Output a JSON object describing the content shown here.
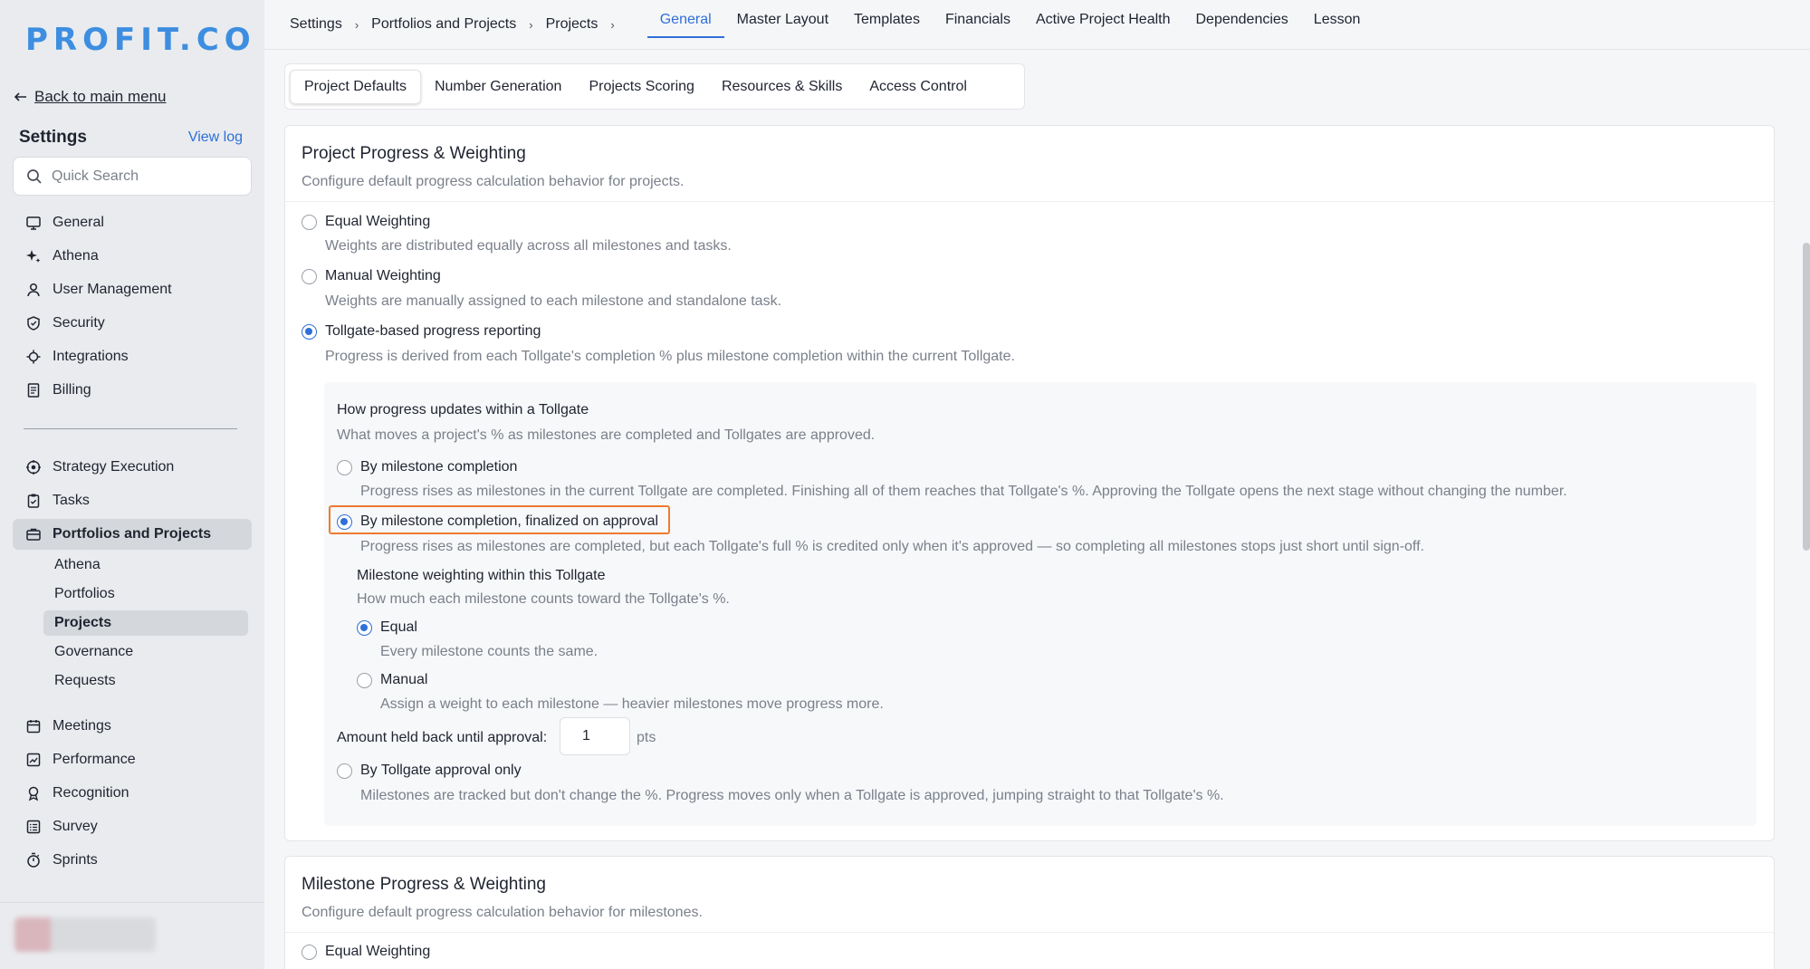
{
  "brand": {
    "logo": "PROFIT.CO",
    "accent": "#2f6fd8"
  },
  "sidebar": {
    "back_label": "Back to main menu",
    "settings_title": "Settings",
    "view_log": "View log",
    "search_placeholder": "Quick Search",
    "group1": [
      {
        "label": "General",
        "icon": "monitor-icon"
      },
      {
        "label": "Athena",
        "icon": "sparkle-icon"
      },
      {
        "label": "User Management",
        "icon": "user-icon"
      },
      {
        "label": "Security",
        "icon": "shield-icon"
      },
      {
        "label": "Integrations",
        "icon": "plug-icon"
      },
      {
        "label": "Billing",
        "icon": "receipt-icon"
      }
    ],
    "group2": [
      {
        "label": "Strategy Execution",
        "icon": "target-icon"
      },
      {
        "label": "Tasks",
        "icon": "clipboard-check-icon"
      },
      {
        "label": "Portfolios and Projects",
        "icon": "briefcase-icon",
        "active": true
      }
    ],
    "sub_items": [
      {
        "label": "Athena"
      },
      {
        "label": "Portfolios"
      },
      {
        "label": "Projects",
        "active": true
      },
      {
        "label": "Governance"
      },
      {
        "label": "Requests"
      }
    ],
    "group3": [
      {
        "label": "Meetings",
        "icon": "calendar-icon"
      },
      {
        "label": "Performance",
        "icon": "chart-icon"
      },
      {
        "label": "Recognition",
        "icon": "award-icon"
      },
      {
        "label": "Survey",
        "icon": "list-icon"
      },
      {
        "label": "Sprints",
        "icon": "stopwatch-icon"
      }
    ]
  },
  "breadcrumb": [
    "Settings",
    "Portfolios and Projects",
    "Projects"
  ],
  "top_tabs": [
    {
      "label": "General",
      "active": true
    },
    {
      "label": "Master Layout"
    },
    {
      "label": "Templates"
    },
    {
      "label": "Financials"
    },
    {
      "label": "Active Project Health"
    },
    {
      "label": "Dependencies"
    },
    {
      "label": "Lesson"
    }
  ],
  "sub_tabs": [
    {
      "label": "Project Defaults",
      "active": true
    },
    {
      "label": "Number Generation"
    },
    {
      "label": "Projects Scoring"
    },
    {
      "label": "Resources & Skills"
    },
    {
      "label": "Access Control"
    }
  ],
  "project_card": {
    "title": "Project Progress & Weighting",
    "subtitle": "Configure default progress calculation behavior for projects.",
    "options": [
      {
        "label": "Equal Weighting",
        "desc": "Weights are distributed equally across all milestones and tasks."
      },
      {
        "label": "Manual Weighting",
        "desc": "Weights are manually assigned to each milestone and standalone task."
      },
      {
        "label": "Tollgate-based progress reporting",
        "desc": "Progress is derived from each Tollgate's completion % plus milestone completion within the current Tollgate."
      }
    ],
    "tollgate": {
      "title": "How progress updates within a Tollgate",
      "subtitle": "What moves a project's % as milestones are completed and Tollgates are approved.",
      "options": [
        {
          "label": "By milestone completion",
          "desc": "Progress rises as milestones in the current Tollgate are completed. Finishing all of them reaches that Tollgate's %. Approving the Tollgate opens the next stage without changing the number."
        },
        {
          "label": "By milestone completion, finalized on approval",
          "desc": "Progress rises as milestones are completed, but each Tollgate's full % is credited only when it's approved — so completing all milestones stops just short until sign-off."
        },
        {
          "label": "By Tollgate approval only",
          "desc": "Milestones are tracked but don't change the %. Progress moves only when a Tollgate is approved, jumping straight to that Tollgate's %."
        }
      ],
      "weighting": {
        "title": "Milestone weighting within this Tollgate",
        "subtitle": "How much each milestone counts toward the Tollgate's %.",
        "options": [
          {
            "label": "Equal",
            "desc": "Every milestone counts the same."
          },
          {
            "label": "Manual",
            "desc": "Assign a weight to each milestone — heavier milestones move progress more."
          }
        ]
      },
      "held_back_label": "Amount held back until approval:",
      "held_back_value": "1",
      "held_back_unit": "pts"
    }
  },
  "milestone_card": {
    "title": "Milestone Progress & Weighting",
    "subtitle": "Configure default progress calculation behavior for milestones.",
    "first_option": "Equal Weighting"
  }
}
